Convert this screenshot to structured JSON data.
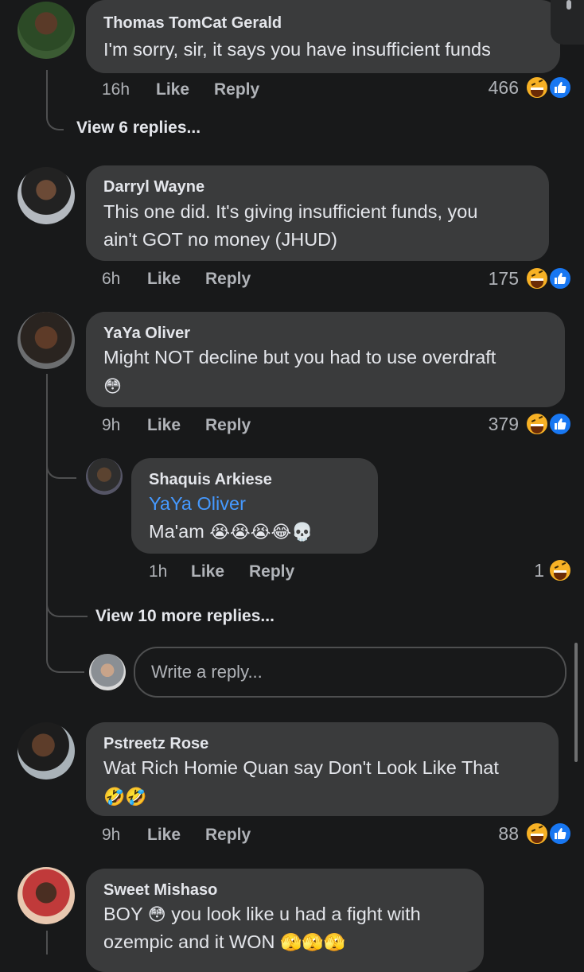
{
  "comments": [
    {
      "author": "Thomas TomCat Gerald",
      "text": "I'm sorry, sir, it says you have insufficient funds",
      "time": "16h",
      "like_label": "Like",
      "reply_label": "Reply",
      "reaction_count": "466"
    },
    {
      "author": "Darryl Wayne",
      "text_line1": "This one did. It's giving insufficient funds, you",
      "text_line2": "ain't GOT no money (JHUD)",
      "time": "6h",
      "like_label": "Like",
      "reply_label": "Reply",
      "reaction_count": "175"
    },
    {
      "author": "YaYa Oliver",
      "text": "Might NOT decline but you had to use overdraft",
      "time": "9h",
      "like_label": "Like",
      "reply_label": "Reply",
      "reaction_count": "379",
      "reply": {
        "author": "Shaquis Arkiese",
        "mention": "YaYa Oliver",
        "text": "Ma'am",
        "time": "1h",
        "like_label": "Like",
        "reply_label": "Reply",
        "reaction_count": "1"
      }
    },
    {
      "author": "Pstreetz Rose",
      "text": "Wat Rich Homie Quan say Don't Look Like That",
      "time": "9h",
      "like_label": "Like",
      "reply_label": "Reply",
      "reaction_count": "88"
    },
    {
      "author": "Sweet Mishaso",
      "text_part1": "BOY",
      "text_part2": "you look like u had a fight with",
      "text_line2": "ozempic and it WON"
    }
  ],
  "view_replies_1": "View 6 replies...",
  "view_replies_2": "View 10 more replies...",
  "reply_box": {
    "placeholder": "Write a reply..."
  },
  "icons": {
    "reaction_laugh": "haha-reaction-icon",
    "reaction_like": "like-reaction-icon",
    "emoji_flushed": "😳",
    "emoji_sob": "😭",
    "emoji_joy": "😂",
    "emoji_skull": "💀",
    "emoji_rofl": "🤣",
    "emoji_peeking": "🫣"
  },
  "colors": {
    "background": "#18191a",
    "bubble": "#3a3b3c",
    "link": "#4599ff",
    "like_blue": "#1877f2",
    "haha_yellow": "#f7b125"
  }
}
